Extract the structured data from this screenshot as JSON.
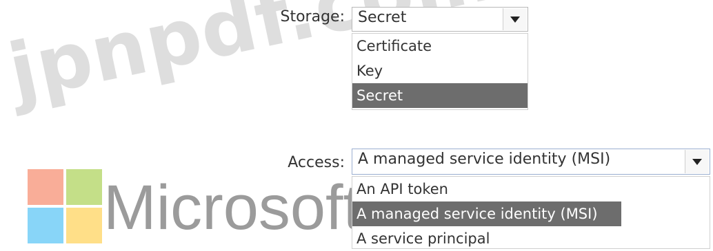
{
  "storage": {
    "label": "Storage:",
    "selected": "Secret",
    "options": [
      "Certificate",
      "Key",
      "Secret"
    ],
    "selected_index": 2
  },
  "access": {
    "label": "Access:",
    "selected": "A managed service identity (MSI)",
    "options": [
      "An API token",
      "A managed service identity (MSI)",
      "A service principal"
    ],
    "selected_index": 1
  },
  "watermark": {
    "site_text": "jpnpdf.com",
    "brand_text": "Microsoft",
    "logo_colors": [
      "#f25022",
      "#7fba00",
      "#00a4ef",
      "#ffb900"
    ]
  },
  "icons": {
    "dropdown_arrow": "chevron-down-icon",
    "logo": "microsoft-logo-icon"
  },
  "colors": {
    "selected_bg": "#6d6d6d",
    "selected_fg": "#ffffff",
    "border": "#b8b8b8"
  }
}
